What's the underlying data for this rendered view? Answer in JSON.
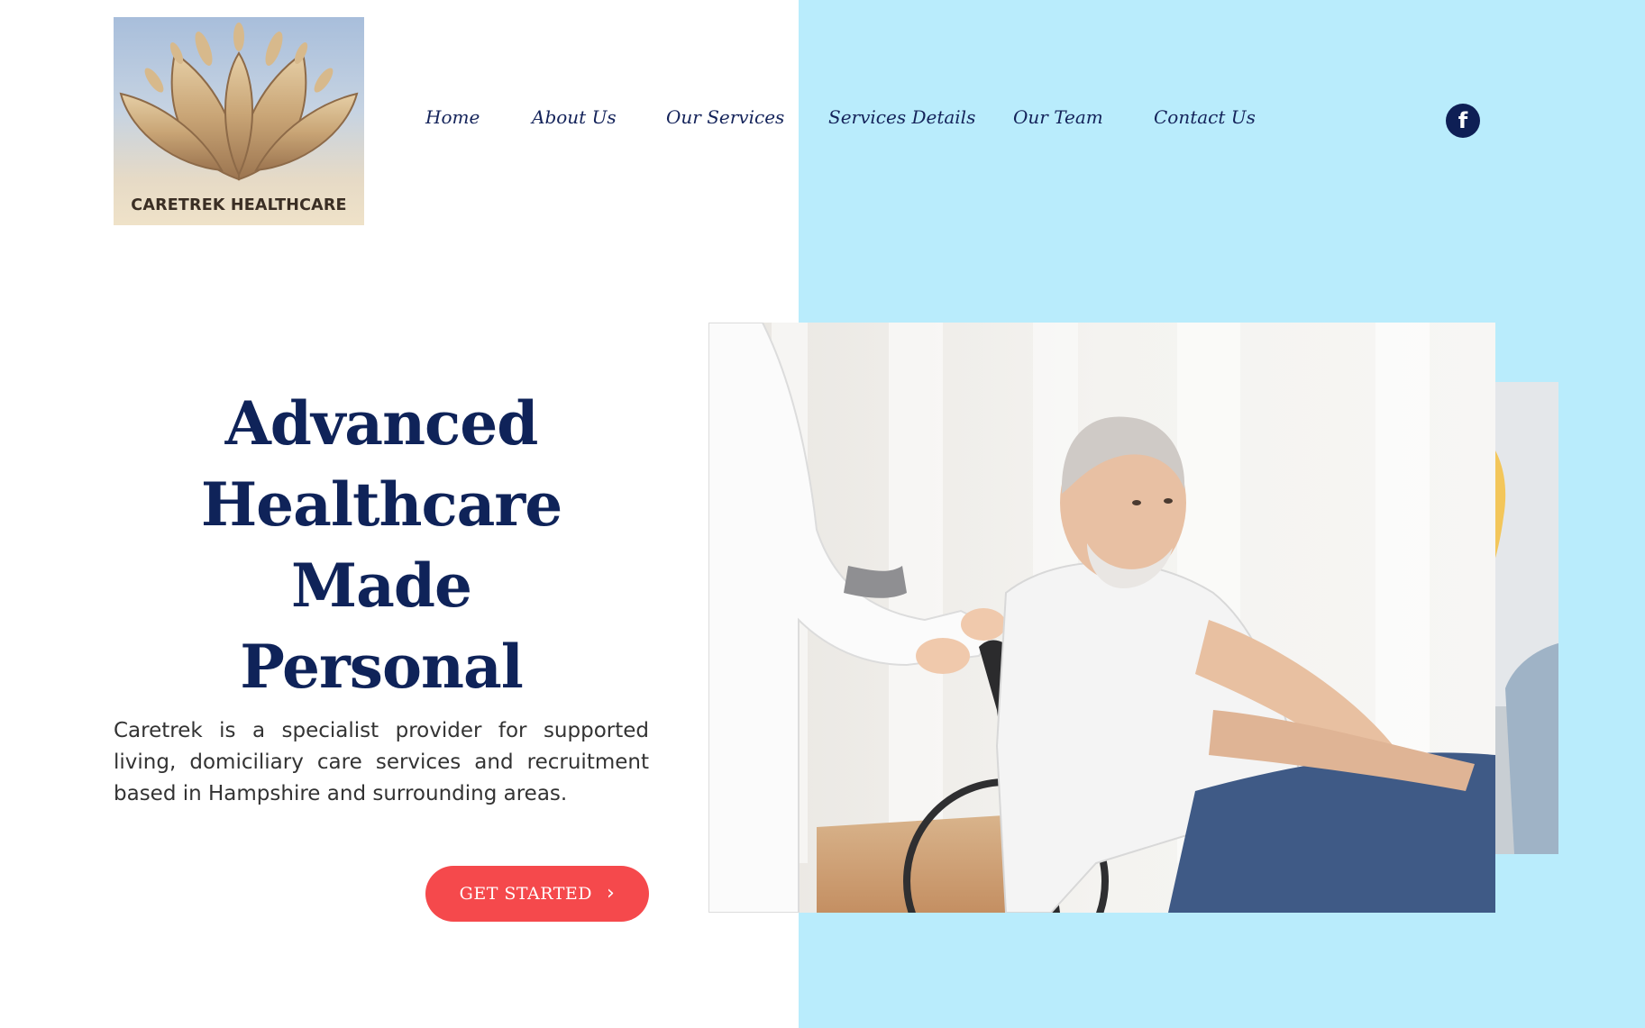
{
  "brand": {
    "logo_text": "CARETREK HEALTHCARE",
    "accent_color": "#b9ecfc",
    "navy_color": "#0f2359",
    "cta_color": "#f5494c"
  },
  "nav": {
    "items": [
      {
        "label": "Home"
      },
      {
        "label": "About Us"
      },
      {
        "label": "Our Services"
      },
      {
        "label": "Services Details"
      },
      {
        "label": "Our Team"
      },
      {
        "label": "Contact Us"
      }
    ],
    "social": {
      "icon": "facebook-icon",
      "glyph": "f"
    }
  },
  "hero": {
    "title_line1": "Advanced",
    "title_line2": "Healthcare Made",
    "title_line3": "Personal",
    "description": "Caretrek is a specialist provider for supported living, domiciliary care services and recruitment based in Hampshire and surrounding areas.",
    "cta_label": "GET STARTED",
    "cta_icon": "chevron-right-icon",
    "cta_glyph": "›"
  },
  "images": {
    "main": "photo-nurse-with-elderly-man-in-wheelchair",
    "secondary": "photo-yellow-clothing-partial"
  }
}
